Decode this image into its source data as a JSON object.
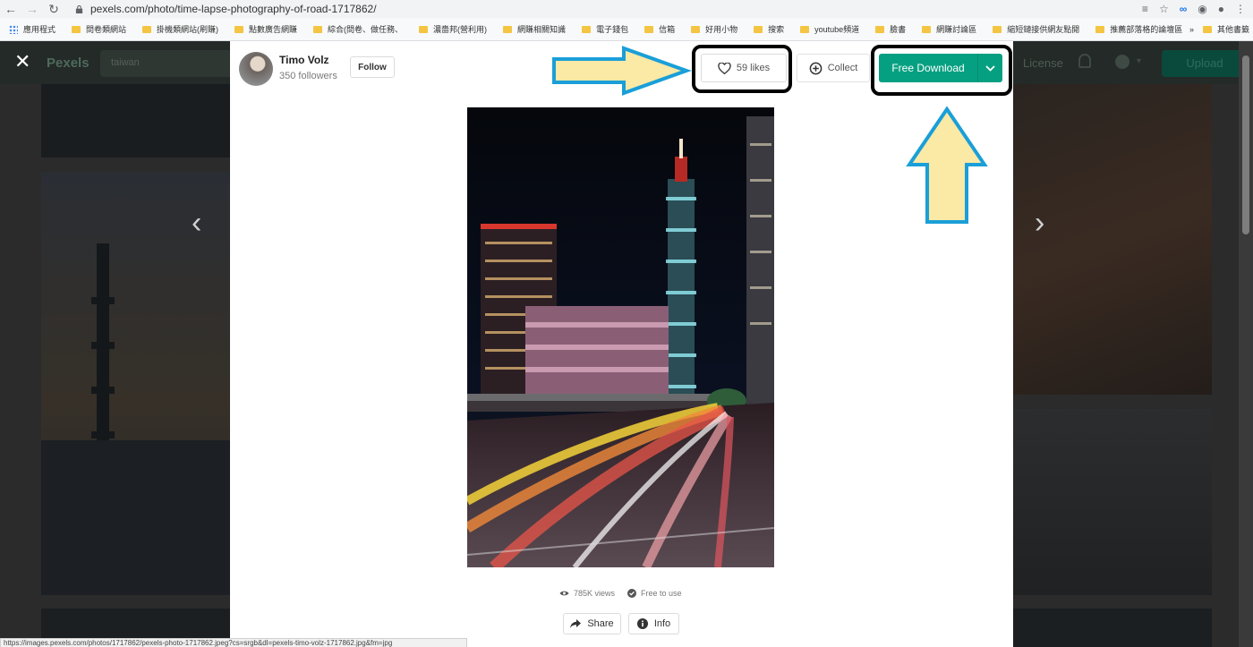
{
  "browser": {
    "url": "pexels.com/photo/time-lapse-photography-of-road-1717862/",
    "bookmarks": [
      "應用程式",
      "問卷類網站",
      "掛機類網站(刷賺)",
      "點數廣告網賺",
      "綜合(問卷、做任務、",
      "濃嗇邦(營利用)",
      "網賺相關知識",
      "電子錢包",
      "信箱",
      "好用小物",
      "搜索",
      "youtube頻道",
      "臉書",
      "網賺討論區",
      "縮短鏈接供網友點閱",
      "推薦部落格的論壇區"
    ],
    "other_bookmarks": "其他書籤",
    "overflow": "»",
    "status_url": "https://images.pexels.com/photos/1717862/pexels-photo-1717862.jpeg?cs=srgb&dl=pexels-timo-volz-1717862.jpg&fm=jpg"
  },
  "site": {
    "brand": "Pexels",
    "search_value": "taiwan",
    "license_label": "License",
    "upload_label": "Upload"
  },
  "modal": {
    "author_name": "Timo Volz",
    "author_followers": "350 followers",
    "follow_label": "Follow",
    "likes_label": "59 likes",
    "collect_label": "Collect",
    "download_label": "Free Download",
    "views_label": "785K views",
    "free_label": "Free to use",
    "share_label": "Share",
    "info_label": "Info"
  },
  "colors": {
    "download_green": "#05a081",
    "annotation_fill": "#fbe9a6",
    "annotation_stroke": "#1a9fd8"
  },
  "icons": [
    "back-icon",
    "forward-icon",
    "reload-icon",
    "lock-icon",
    "heart-icon",
    "plus-circle-icon",
    "chevron-down-icon",
    "eye-icon",
    "check-circle-icon",
    "share-icon",
    "info-icon",
    "close-icon",
    "chevron-left-icon",
    "chevron-right-icon"
  ]
}
